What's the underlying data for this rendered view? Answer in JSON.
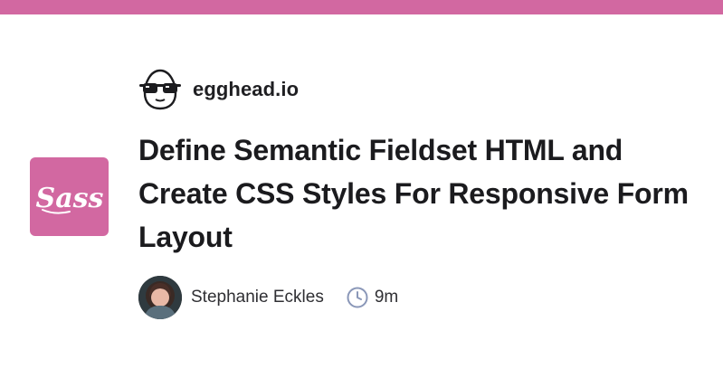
{
  "brand": {
    "name": "egghead.io",
    "logo_icon": "egghead-logo-icon"
  },
  "course_icon": {
    "name": "sass-logo-icon",
    "text": "Sass",
    "color": "#d268a1"
  },
  "lesson": {
    "title": "Define Semantic Fieldset HTML and Create CSS Styles For Responsive Form Layout"
  },
  "meta": {
    "author": "Stephanie Eckles",
    "duration": "9m",
    "duration_icon": "clock-icon"
  },
  "colors": {
    "accent": "#d268a1",
    "text": "#1b1b1e",
    "muted": "#2f2f33",
    "clock": "#8a97b8"
  }
}
